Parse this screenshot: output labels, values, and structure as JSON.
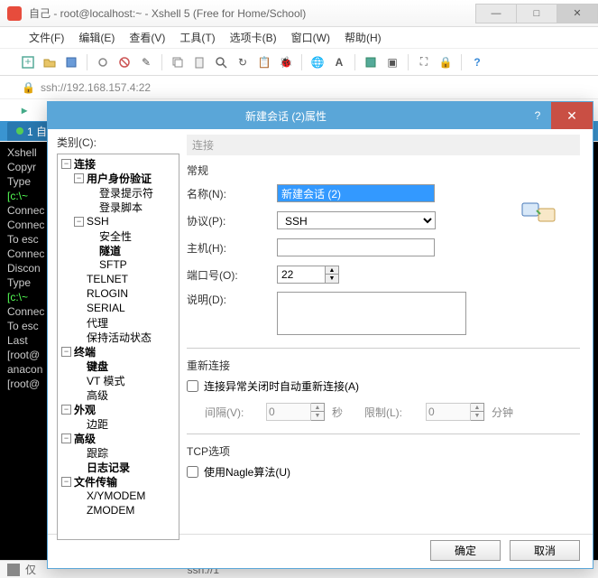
{
  "window": {
    "title": "自己 - root@localhost:~ - Xshell 5 (Free for Home/School)"
  },
  "menu": [
    "文件(F)",
    "编辑(E)",
    "查看(V)",
    "工具(T)",
    "选项卡(B)",
    "窗口(W)",
    "帮助(H)"
  ],
  "address": "ssh://192.168.157.4:22",
  "sessiontab": "1 自",
  "terminal_lines": [
    {
      "t": "Xshell",
      "c": ""
    },
    {
      "t": "Copyr",
      "c": ""
    },
    {
      "t": "",
      "c": ""
    },
    {
      "t": "Type ",
      "c": ""
    },
    {
      "t": "[c:\\~",
      "c": "g"
    },
    {
      "t": "",
      "c": ""
    },
    {
      "t": "Connec",
      "c": ""
    },
    {
      "t": "Connec",
      "c": ""
    },
    {
      "t": "To esc",
      "c": ""
    },
    {
      "t": "",
      "c": ""
    },
    {
      "t": "Connec",
      "c": ""
    },
    {
      "t": "",
      "c": ""
    },
    {
      "t": "Discon",
      "c": ""
    },
    {
      "t": "",
      "c": ""
    },
    {
      "t": "Type ",
      "c": ""
    },
    {
      "t": "[c:\\~",
      "c": "g"
    },
    {
      "t": "",
      "c": ""
    },
    {
      "t": "Connec",
      "c": ""
    },
    {
      "t": "To esc",
      "c": ""
    },
    {
      "t": "",
      "c": ""
    },
    {
      "t": "Last ",
      "c": ""
    },
    {
      "t": "[root@",
      "c": ""
    },
    {
      "t": "anacon",
      "c": ""
    },
    {
      "t": "[root@",
      "c": ""
    }
  ],
  "statusbar": {
    "left": "仅",
    "conn": "ssh://1"
  },
  "dialog": {
    "title": "新建会话 (2)属性",
    "tree_label": "类别(C):",
    "tree": [
      {
        "d": 0,
        "tw": "−",
        "lbl": "连接",
        "b": 1
      },
      {
        "d": 1,
        "tw": "−",
        "lbl": "用户身份验证",
        "b": 1
      },
      {
        "d": 2,
        "tw": "",
        "lbl": "登录提示符",
        "b": 0
      },
      {
        "d": 2,
        "tw": "",
        "lbl": "登录脚本",
        "b": 0
      },
      {
        "d": 1,
        "tw": "−",
        "lbl": "SSH",
        "b": 0
      },
      {
        "d": 2,
        "tw": "",
        "lbl": "安全性",
        "b": 0
      },
      {
        "d": 2,
        "tw": "",
        "lbl": "隧道",
        "b": 1
      },
      {
        "d": 2,
        "tw": "",
        "lbl": "SFTP",
        "b": 0
      },
      {
        "d": 1,
        "tw": "",
        "lbl": "TELNET",
        "b": 0
      },
      {
        "d": 1,
        "tw": "",
        "lbl": "RLOGIN",
        "b": 0
      },
      {
        "d": 1,
        "tw": "",
        "lbl": "SERIAL",
        "b": 0
      },
      {
        "d": 1,
        "tw": "",
        "lbl": "代理",
        "b": 0
      },
      {
        "d": 1,
        "tw": "",
        "lbl": "保持活动状态",
        "b": 0
      },
      {
        "d": 0,
        "tw": "−",
        "lbl": "终端",
        "b": 1
      },
      {
        "d": 1,
        "tw": "",
        "lbl": "键盘",
        "b": 1
      },
      {
        "d": 1,
        "tw": "",
        "lbl": "VT 模式",
        "b": 0
      },
      {
        "d": 1,
        "tw": "",
        "lbl": "高级",
        "b": 0
      },
      {
        "d": 0,
        "tw": "−",
        "lbl": "外观",
        "b": 1
      },
      {
        "d": 1,
        "tw": "",
        "lbl": "边距",
        "b": 0
      },
      {
        "d": 0,
        "tw": "−",
        "lbl": "高级",
        "b": 1
      },
      {
        "d": 1,
        "tw": "",
        "lbl": "跟踪",
        "b": 0
      },
      {
        "d": 1,
        "tw": "",
        "lbl": "日志记录",
        "b": 1
      },
      {
        "d": 0,
        "tw": "−",
        "lbl": "文件传输",
        "b": 1
      },
      {
        "d": 1,
        "tw": "",
        "lbl": "X/YMODEM",
        "b": 0
      },
      {
        "d": 1,
        "tw": "",
        "lbl": "ZMODEM",
        "b": 0
      }
    ],
    "panel_title": "连接",
    "general": {
      "group": "常规",
      "name_label": "名称(N):",
      "name_value": "新建会话 (2)",
      "proto_label": "协议(P):",
      "proto_value": "SSH",
      "host_label": "主机(H):",
      "host_value": "",
      "port_label": "端口号(O):",
      "port_value": "22",
      "desc_label": "说明(D):",
      "desc_value": ""
    },
    "reconnect": {
      "group": "重新连接",
      "chk_label": "连接异常关闭时自动重新连接(A)",
      "interval_label": "间隔(V):",
      "interval_value": "0",
      "interval_unit": "秒",
      "limit_label": "限制(L):",
      "limit_value": "0",
      "limit_unit": "分钟"
    },
    "tcp": {
      "group": "TCP选项",
      "nagle_label": "使用Nagle算法(U)"
    },
    "ok": "确定",
    "cancel": "取消"
  }
}
